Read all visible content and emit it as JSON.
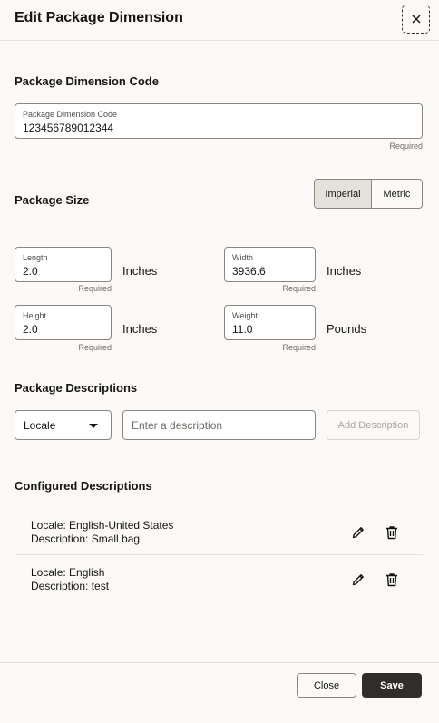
{
  "dialog": {
    "title": "Edit Package Dimension",
    "close_icon": "close-icon"
  },
  "code_section": {
    "title": "Package Dimension Code",
    "field_label": "Package Dimension Code",
    "field_value": "123456789012344",
    "required": "Required"
  },
  "size_section": {
    "title": "Package Size",
    "toggle": {
      "options": [
        "Imperial",
        "Metric"
      ],
      "selected": "Imperial"
    },
    "fields": [
      {
        "label": "Length",
        "value": "2.0",
        "unit": "Inches",
        "required": "Required"
      },
      {
        "label": "Width",
        "value": "3936.6",
        "unit": "Inches",
        "required": "Required"
      },
      {
        "label": "Height",
        "value": "2.0",
        "unit": "Inches",
        "required": "Required"
      },
      {
        "label": "Weight",
        "value": "11.0",
        "unit": "Pounds",
        "required": "Required"
      }
    ]
  },
  "descriptions_section": {
    "title": "Package Descriptions",
    "locale_select": "Locale",
    "description_placeholder": "Enter a description",
    "add_button": "Add Description"
  },
  "configured": {
    "title": "Configured Descriptions",
    "items": [
      {
        "locale": "Locale: English-United States",
        "description": "Description: Small bag"
      },
      {
        "locale": "Locale: English",
        "description": "Description: test"
      }
    ]
  },
  "footer": {
    "close_label": "Close",
    "save_label": "Save"
  }
}
